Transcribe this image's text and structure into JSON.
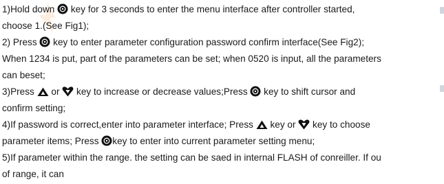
{
  "instructions": {
    "l1a": "1)Hold down ",
    "l1b": " key for 3 seconds to enter the menu interface after controller started,",
    "l2": "choose 1.(See Fig1);",
    "l3a": "2) Press ",
    "l3b": " key to enter parameter configuration password confirm interface(See Fig2);",
    "l4": "When 1234 is put, part of the parameters can be set; when 0520 is input, all the parameters",
    "l5": "can beset;",
    "l6a": "3)Press ",
    "l6b": " or ",
    "l6c": " key to increase or decrease values;Press ",
    "l6d": " key to shift cursor and",
    "l7": " confirm setting;",
    "l8a": "4)If password is correct,enter into parameter interface; Press ",
    "l8b": " key or ",
    "l8c": " key to choose",
    "l9a": "parameter items; Press ",
    "l9b": "key to enter into current parameter setting menu;",
    "l10": "5)If parameter within the range. the setting can be saed in internal FLASH of conreiller. If ou",
    "l11": "of range, it can"
  },
  "icons": {
    "set": "set-key-icon",
    "up": "up-triangle-icon",
    "down": "down-heart-icon"
  },
  "colors": {
    "text": "#1a1a1a",
    "icon": "#111111",
    "watermark": "#f5a05a"
  }
}
